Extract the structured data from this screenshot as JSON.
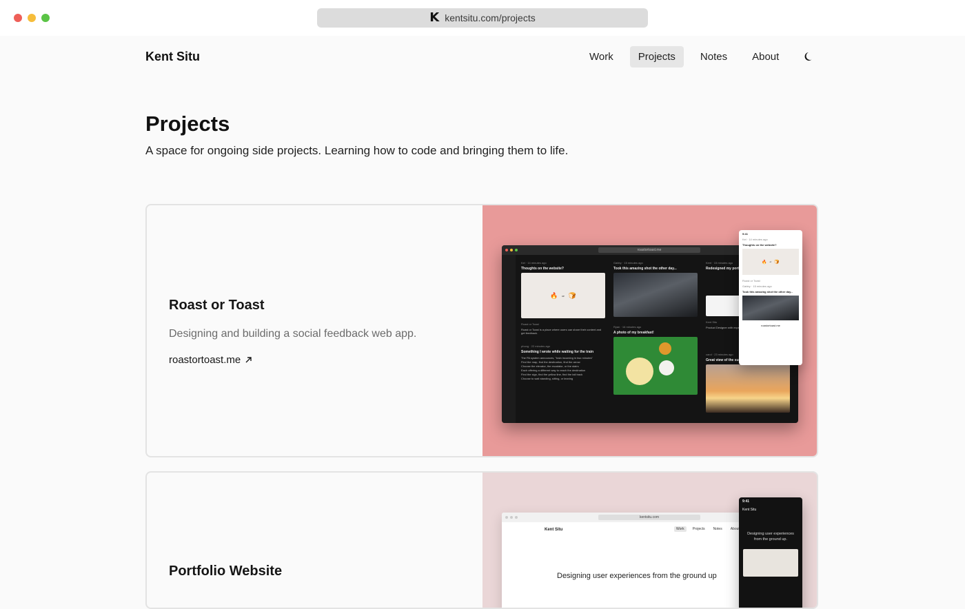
{
  "browser": {
    "url": "kentsitu.com/projects",
    "favicon": "K",
    "traffic_lights": [
      "#ee5f58",
      "#f6bd3b",
      "#5bc446"
    ]
  },
  "header": {
    "brand": "Kent Situ",
    "nav": [
      {
        "label": "Work",
        "active": false
      },
      {
        "label": "Projects",
        "active": true
      },
      {
        "label": "Notes",
        "active": false
      },
      {
        "label": "About",
        "active": false
      }
    ],
    "theme_toggle_icon": "moon-icon"
  },
  "page": {
    "title": "Projects",
    "description": "A space for ongoing side projects. Learning how to code and bringing them to life."
  },
  "projects": [
    {
      "title": "Roast or Toast",
      "description": "Designing and building a social feedback web app.",
      "link_label": "roastortoast.me",
      "link_icon": "arrow-up-right-icon",
      "accent": "#e89a99",
      "mock": {
        "url": "roastortoast.me",
        "posts": [
          {
            "user": "Kel · 14 minutes ago",
            "title": "Thoughts on the website?"
          },
          {
            "user": "Gabby · 15 minutes ago",
            "title": "Took this amazing shot the other day..."
          },
          {
            "user": "Kent · 15 minutes ago",
            "title": "Redesigned my portfo..."
          },
          {
            "user": "Roast or Toast",
            "title": "Roast or Toast is a place where users can share their content and get feedback."
          },
          {
            "user": "Ryan · 16 minutes ago",
            "title": "A photo of my breakfast!"
          },
          {
            "user": "Kent Situ",
            "title": "Product Designer with experience, research..."
          },
          {
            "user": "phong · 22 minutes ago",
            "title": "Something I wrote while waiting for the train"
          },
          {
            "user": "carol · 23 minutes ago",
            "title": "Great view of the sunset in SD"
          }
        ],
        "phone_time": "9:41",
        "phone_url": "roastortoast.me"
      }
    },
    {
      "title": "Portfolio Website",
      "accent": "#ead6d7",
      "mock": {
        "url": "kentsitu.com",
        "brand": "Kent Situ",
        "nav": [
          "Work",
          "Projects",
          "Notes",
          "About"
        ],
        "headline": "Designing user experiences from the ground up",
        "phone_time": "9:41",
        "phone_brand": "Kent Situ",
        "phone_headline": "Designing user experiences from the ground up."
      }
    }
  ]
}
